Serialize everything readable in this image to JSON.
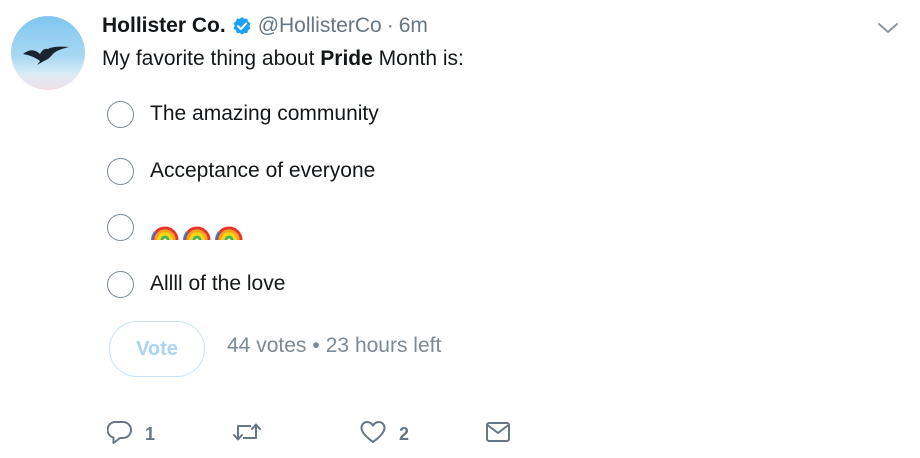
{
  "tweet": {
    "author_name": "Hollister Co.",
    "handle": "@HollisterCo",
    "separator": "·",
    "time": "6m",
    "text_before": "My favorite thing about ",
    "text_bold": "Pride",
    "text_after": " Month is:"
  },
  "poll": {
    "options": [
      {
        "label": "The amazing community"
      },
      {
        "label": "Acceptance of everyone"
      },
      {
        "label": "",
        "icon": "rainbow-emoji",
        "icon_count": 3
      },
      {
        "label": "Allll of the love"
      }
    ],
    "vote_label": "Vote",
    "votes_text": "44 votes",
    "meta_separator": "•",
    "time_left": "23 hours left"
  },
  "actions": {
    "reply_count": "1",
    "retweet_count": "",
    "like_count": "2"
  },
  "colors": {
    "verified_blue": "#1da1f2",
    "muted_text": "#657786",
    "vote_button_text": "#a9d4f2"
  },
  "icons": {
    "verified": "verified-badge-icon",
    "caret": "chevron-down-icon",
    "reply": "reply-icon",
    "retweet": "retweet-icon",
    "like": "heart-icon",
    "dm": "envelope-icon"
  }
}
